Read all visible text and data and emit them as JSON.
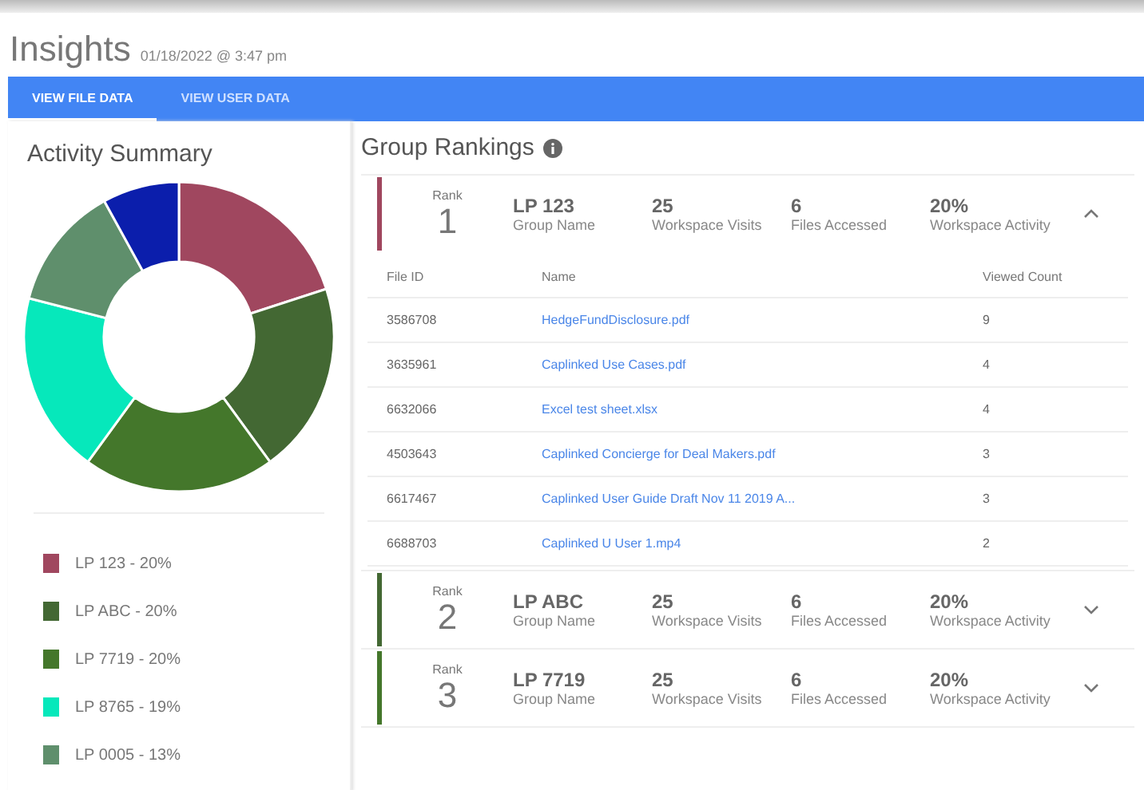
{
  "header": {
    "title": "Insights",
    "timestamp": "01/18/2022 @ 3:47 pm"
  },
  "tabs": [
    {
      "label": "VIEW FILE DATA",
      "selected": true
    },
    {
      "label": "VIEW USER DATA",
      "selected": false
    }
  ],
  "activity_summary": {
    "title": "Activity Summary",
    "chart_data": {
      "type": "donut",
      "values": [
        20,
        20,
        20,
        19,
        13,
        8
      ],
      "colors": [
        "#a0475f",
        "#436833",
        "#44772b",
        "#06e8bb",
        "#5f8f6c",
        "#0b1eac"
      ]
    },
    "legend": [
      {
        "label": "LP 123 - 20%",
        "color": "#a0475f"
      },
      {
        "label": "LP ABC - 20%",
        "color": "#436833"
      },
      {
        "label": "LP 7719 - 20%",
        "color": "#44772b"
      },
      {
        "label": "LP 8765 - 19%",
        "color": "#06e8bb"
      },
      {
        "label": "LP 0005 - 13%",
        "color": "#5f8f6c"
      }
    ]
  },
  "group_rankings": {
    "title": "Group Rankings",
    "groups": [
      {
        "rank_label": "Rank",
        "rank": "1",
        "color": "#a0475f",
        "expanded": true,
        "name": "LP 123",
        "name_label": "Group Name",
        "visits": "25",
        "visits_label": "Workspace Visits",
        "files_accessed": "6",
        "files_label": "Files Accessed",
        "activity": "20%",
        "activity_label": "Workspace Activity",
        "files_table": {
          "columns": [
            "File ID",
            "Name",
            "Viewed Count"
          ],
          "rows": [
            {
              "file_id": "3586708",
              "name": "HedgeFundDisclosure.pdf",
              "viewed_count": "9"
            },
            {
              "file_id": "3635961",
              "name": "Caplinked Use Cases.pdf",
              "viewed_count": "4"
            },
            {
              "file_id": "6632066",
              "name": "Excel test sheet.xlsx",
              "viewed_count": "4"
            },
            {
              "file_id": "4503643",
              "name": "Caplinked Concierge for Deal Makers.pdf",
              "viewed_count": "3"
            },
            {
              "file_id": "6617467",
              "name": "Caplinked User Guide Draft Nov 11 2019 A...",
              "viewed_count": "3"
            },
            {
              "file_id": "6688703",
              "name": "Caplinked U User 1.mp4",
              "viewed_count": "2"
            }
          ]
        }
      },
      {
        "rank_label": "Rank",
        "rank": "2",
        "color": "#436833",
        "expanded": false,
        "name": "LP ABC",
        "name_label": "Group Name",
        "visits": "25",
        "visits_label": "Workspace Visits",
        "files_accessed": "6",
        "files_label": "Files Accessed",
        "activity": "20%",
        "activity_label": "Workspace Activity"
      },
      {
        "rank_label": "Rank",
        "rank": "3",
        "color": "#44772b",
        "expanded": false,
        "name": "LP 7719",
        "name_label": "Group Name",
        "visits": "25",
        "visits_label": "Workspace Visits",
        "files_accessed": "6",
        "files_label": "Files Accessed",
        "activity": "20%",
        "activity_label": "Workspace Activity"
      }
    ]
  }
}
